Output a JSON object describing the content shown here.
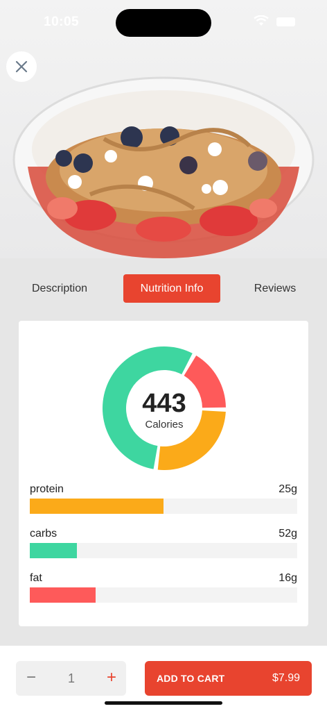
{
  "status_bar": {
    "time": "10:05"
  },
  "product_image": {
    "icon": "acai-bowl-photo"
  },
  "tabs": [
    {
      "label": "Description",
      "active": false
    },
    {
      "label": "Nutrition Info",
      "active": true
    },
    {
      "label": "Reviews",
      "active": false
    }
  ],
  "nutrition": {
    "calories_value": "443",
    "calories_label": "Calories",
    "macros": [
      {
        "name": "protein",
        "amount": "25g",
        "fraction": 0.5,
        "color": "#fbaa19"
      },
      {
        "name": "carbs",
        "amount": "52g",
        "fraction": 0.175,
        "color": "#3ed6a0"
      },
      {
        "name": "fat",
        "amount": "16g",
        "fraction": 0.245,
        "color": "#fe5a5a"
      }
    ]
  },
  "chart_data": {
    "type": "pie",
    "variant": "donut",
    "center_value": "443",
    "center_label": "Calories",
    "segments": [
      {
        "label": "carbs",
        "value": 52,
        "color": "#3ed6a0"
      },
      {
        "label": "fat",
        "value": 16,
        "color": "#fe5a5a"
      },
      {
        "label": "protein",
        "value": 25,
        "color": "#fbaa19"
      }
    ]
  },
  "cart": {
    "quantity": "1",
    "minus_label": "−",
    "plus_label": "+",
    "button_label": "ADD TO CART",
    "price": "$7.99"
  },
  "colors": {
    "accent": "#e8442f",
    "protein": "#fbaa19",
    "carbs": "#3ed6a0",
    "fat": "#fe5a5a"
  }
}
